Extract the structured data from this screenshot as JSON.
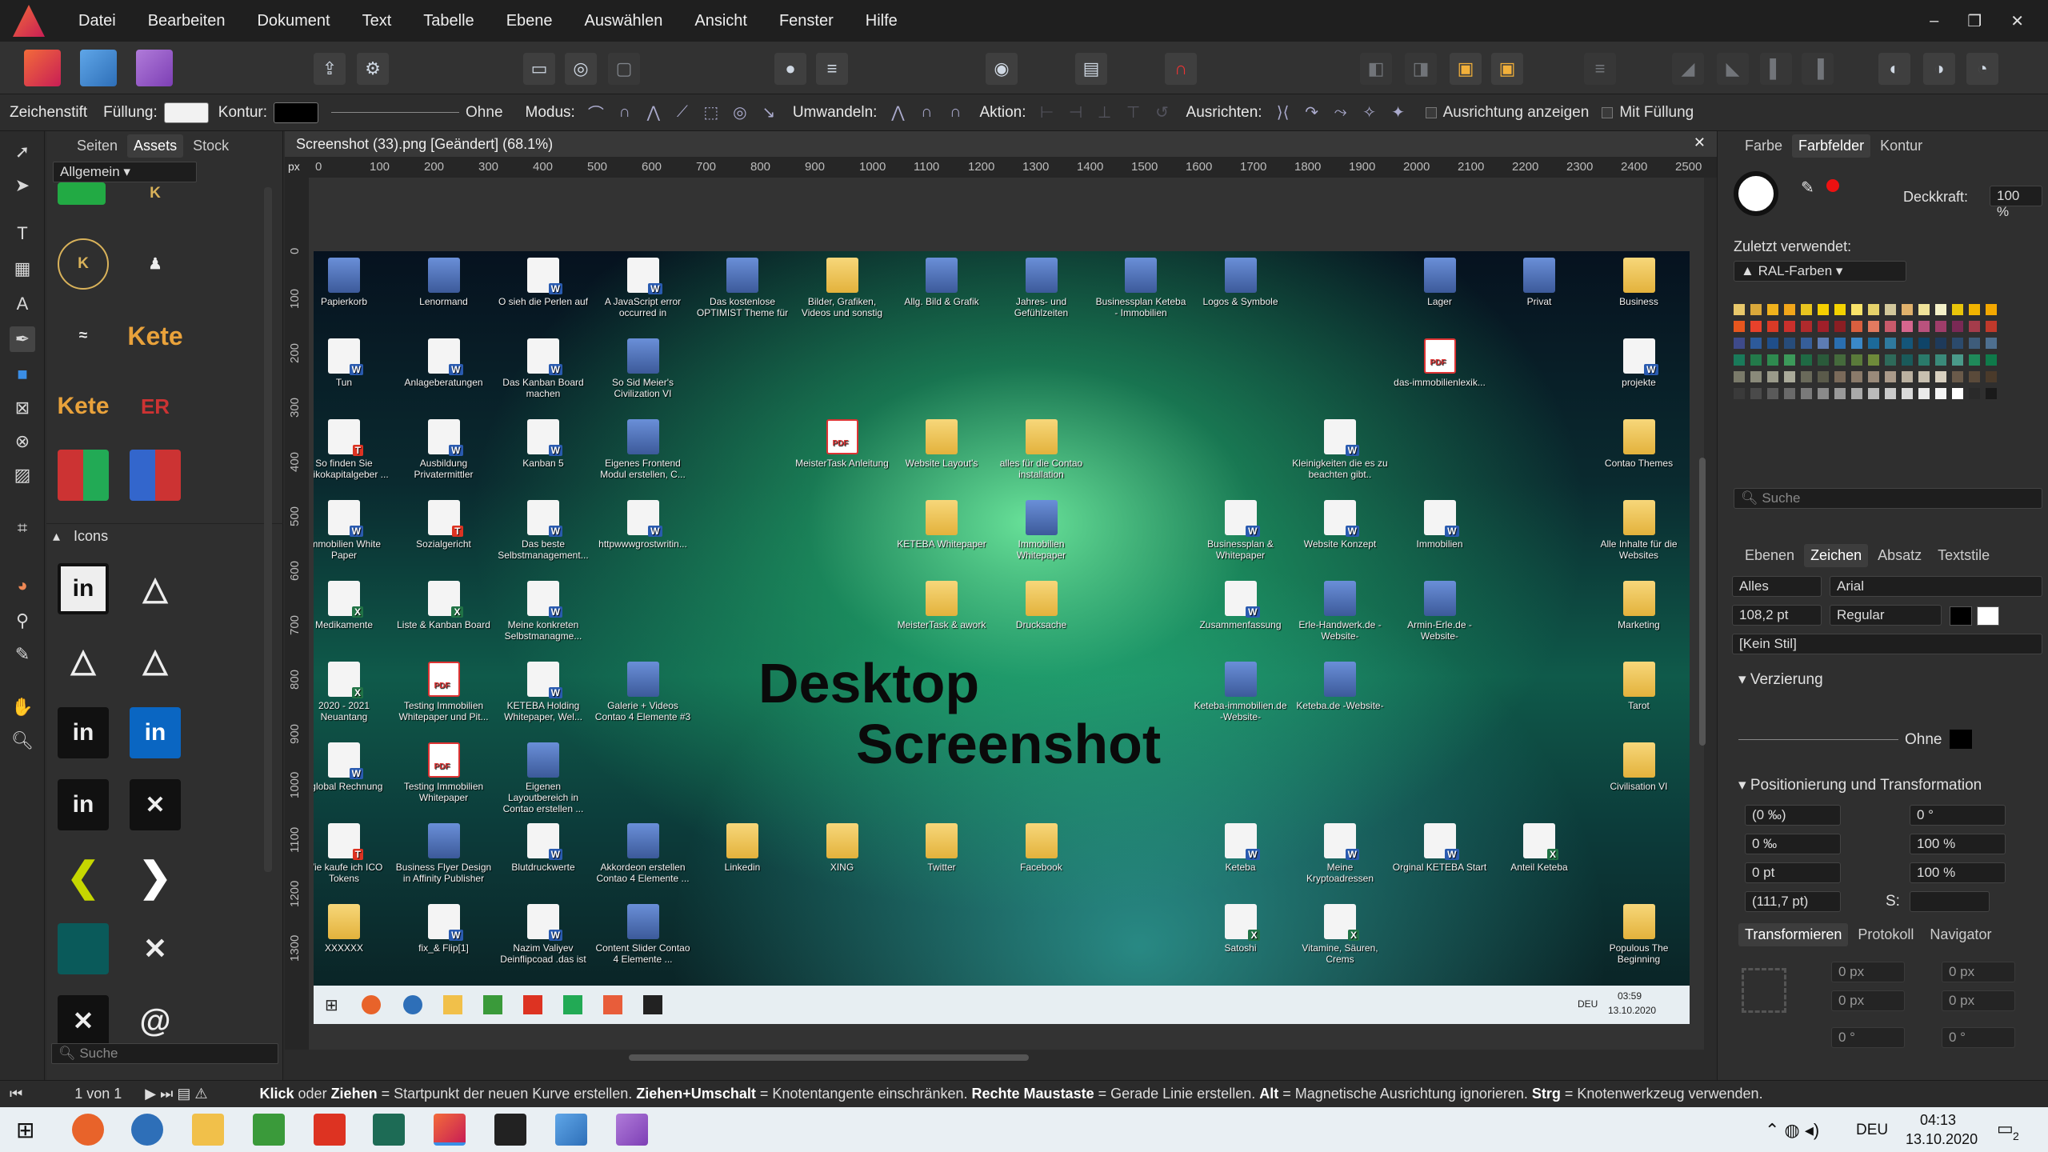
{
  "menu": [
    "Datei",
    "Bearbeiten",
    "Dokument",
    "Text",
    "Tabelle",
    "Ebene",
    "Auswählen",
    "Ansicht",
    "Fenster",
    "Hilfe"
  ],
  "window_controls": {
    "minimize": "–",
    "restore": "❐",
    "close": "✕"
  },
  "context": {
    "tool": "Zeichenstift",
    "fill_label": "Füllung:",
    "stroke_label": "Kontur:",
    "stroke_style": "Ohne",
    "mode_label": "Modus:",
    "convert_label": "Umwandeln:",
    "action_label": "Aktion:",
    "align_label": "Ausrichten:",
    "show_align": "Ausrichtung anzeigen",
    "with_fill": "Mit Füllung"
  },
  "left_panel": {
    "tabs": [
      "Seiten",
      "Assets",
      "Stock"
    ],
    "category": "Allgemein",
    "icons_section": "Icons",
    "search_placeholder": "Suche"
  },
  "document": {
    "title": "Screenshot (33).png [Geändert] (68.1%)",
    "ruler_unit": "px",
    "ruler_h": [
      "0",
      "100",
      "200",
      "300",
      "400",
      "500",
      "600",
      "700",
      "800",
      "900",
      "1000",
      "1100",
      "1200",
      "1300",
      "1400",
      "1500",
      "1600",
      "1700",
      "1800",
      "1900",
      "2000",
      "2100",
      "2200",
      "2300",
      "2400",
      "2500"
    ],
    "ruler_v": [
      "0",
      "100",
      "200",
      "300",
      "400",
      "500",
      "600",
      "700",
      "800",
      "900",
      "1000",
      "1100",
      "1200",
      "1300"
    ],
    "overlay_line1": "Desktop",
    "overlay_line2": "Screenshot",
    "desktop_icons": [
      {
        "label": "Papierkorb",
        "kind": "img"
      },
      {
        "label": "Lenormand",
        "kind": "img"
      },
      {
        "label": "O sieh die Perlen auf",
        "kind": "doc"
      },
      {
        "label": "A JavaScript error occurred in",
        "kind": "doc"
      },
      {
        "label": "Das kostenlose OPTIMIST Theme für",
        "kind": "img"
      },
      {
        "label": "Bilder, Grafiken, Videos und sonstig",
        "kind": "fold"
      },
      {
        "label": "Allg. Bild & Grafik",
        "kind": "img"
      },
      {
        "label": "Jahres- und Gefühlzeiten",
        "kind": "img"
      },
      {
        "label": "Businessplan Keteba - Immobilien",
        "kind": "img"
      },
      {
        "label": "Logos & Symbole",
        "kind": "img"
      },
      {
        "label": "Lager",
        "kind": "img"
      },
      {
        "label": "Privat",
        "kind": "img"
      },
      {
        "label": "Business",
        "kind": "fold"
      },
      {
        "label": "Tun",
        "kind": "doc"
      },
      {
        "label": "Anlageberatungen",
        "kind": "doc"
      },
      {
        "label": "Das Kanban Board machen",
        "kind": "doc"
      },
      {
        "label": "So Sid Meier's Civilization VI",
        "kind": "img"
      },
      {
        "label": "das-immobilienlexik...",
        "kind": "pdf"
      },
      {
        "label": "projekte",
        "kind": "doc"
      },
      {
        "label": "So finden Sie Risikokapitalgeber ...",
        "kind": "ttt"
      },
      {
        "label": "Ausbildung Privatermittler",
        "kind": "doc"
      },
      {
        "label": "Kanban 5",
        "kind": "doc"
      },
      {
        "label": "Eigenes Frontend Modul erstellen, C...",
        "kind": "img"
      },
      {
        "label": "MeisterTask Anleitung",
        "kind": "pdf"
      },
      {
        "label": "Website Layout's",
        "kind": "fold"
      },
      {
        "label": "alles für die Contao installation",
        "kind": "fold"
      },
      {
        "label": "Kleinigkeiten die es zu beachten gibt..",
        "kind": "doc"
      },
      {
        "label": "Contao Themes",
        "kind": "fold"
      },
      {
        "label": "Immobilien White Paper",
        "kind": "doc"
      },
      {
        "label": "Sozialgericht",
        "kind": "ttt"
      },
      {
        "label": "Das beste Selbstmanagement...",
        "kind": "doc"
      },
      {
        "label": "httpwwwgrostwritin...",
        "kind": "doc"
      },
      {
        "label": "KETEBA Whitepaper",
        "kind": "fold"
      },
      {
        "label": "Immobilien Whitepaper",
        "kind": "img"
      },
      {
        "label": "Businessplan & Whitepaper",
        "kind": "doc"
      },
      {
        "label": "Website Konzept",
        "kind": "doc"
      },
      {
        "label": "Immobilien",
        "kind": "doc"
      },
      {
        "label": "Alle Inhalte für die Websites",
        "kind": "fold"
      },
      {
        "label": "Medikamente",
        "kind": "xls"
      },
      {
        "label": "Liste & Kanban Board",
        "kind": "xls"
      },
      {
        "label": "Meine konkreten Selbstmanagme...",
        "kind": "doc"
      },
      {
        "label": "MeisterTask & awork",
        "kind": "fold"
      },
      {
        "label": "Drucksache",
        "kind": "fold"
      },
      {
        "label": "Zusammenfassung",
        "kind": "doc"
      },
      {
        "label": "Erle-Handwerk.de -Website-",
        "kind": "img"
      },
      {
        "label": "Armin-Erle.de -Website-",
        "kind": "img"
      },
      {
        "label": "Marketing",
        "kind": "fold"
      },
      {
        "label": "2020 - 2021 Neuantang",
        "kind": "xls"
      },
      {
        "label": "Testing Immobilien Whitepaper und Pit...",
        "kind": "pdf"
      },
      {
        "label": "KETEBA Holding Whitepaper, Wel...",
        "kind": "doc"
      },
      {
        "label": "Galerie + Videos Contao 4 Elemente #3",
        "kind": "img"
      },
      {
        "label": "Keteba-immobilien.de -Website-",
        "kind": "img"
      },
      {
        "label": "Keteba.de -Website-",
        "kind": "img"
      },
      {
        "label": "Tarot",
        "kind": "fold"
      },
      {
        "label": "eglobal Rechnung",
        "kind": "doc"
      },
      {
        "label": "Testing Immobilien Whitepaper",
        "kind": "pdf"
      },
      {
        "label": "Eigenen Layoutbereich in Contao erstellen ...",
        "kind": "img"
      },
      {
        "label": "Civilisation VI",
        "kind": "fold"
      },
      {
        "label": "Wie kaufe ich ICO Tokens",
        "kind": "ttt"
      },
      {
        "label": "Business Flyer Design in Affinity Publisher",
        "kind": "img"
      },
      {
        "label": "Blutdruckwerte",
        "kind": "doc"
      },
      {
        "label": "Akkordeon erstellen Contao 4 Elemente ...",
        "kind": "img"
      },
      {
        "label": "Linkedin",
        "kind": "fold"
      },
      {
        "label": "XING",
        "kind": "fold"
      },
      {
        "label": "Twitter",
        "kind": "fold"
      },
      {
        "label": "Facebook",
        "kind": "fold"
      },
      {
        "label": "Keteba",
        "kind": "doc"
      },
      {
        "label": "Meine Kryptoadressen",
        "kind": "doc"
      },
      {
        "label": "Orginal KETEBA Start",
        "kind": "doc"
      },
      {
        "label": "Anteil Keteba",
        "kind": "xls"
      },
      {
        "label": "XXXXXX",
        "kind": "fold"
      },
      {
        "label": "fix_& Flip[1]",
        "kind": "doc"
      },
      {
        "label": "Nazim Valiyev Deinflipcoad .das ist",
        "kind": "doc"
      },
      {
        "label": "Content Slider Contao 4 Elemente ...",
        "kind": "img"
      },
      {
        "label": "Satoshi",
        "kind": "xls"
      },
      {
        "label": "Vitamine, Säuren, Crems",
        "kind": "xls"
      },
      {
        "label": "Populous The Beginning",
        "kind": "fold"
      }
    ],
    "inner_taskbar": {
      "lang": "DEU",
      "time": "03:59",
      "date": "13.10.2020"
    }
  },
  "right_panel": {
    "tabs_top": [
      "Farbe",
      "Farbfelder",
      "Kontur"
    ],
    "opacity_label": "Deckkraft:",
    "opacity_value": "100 %",
    "recent_label": "Zuletzt verwendet:",
    "palette": "RAL-Farben",
    "search_placeholder": "Suche",
    "tabs_mid": [
      "Ebenen",
      "Zeichen",
      "Absatz",
      "Textstile"
    ],
    "filter": "Alles",
    "font": "Arial",
    "size": "108,2 pt",
    "weight": "Regular",
    "style": "[Kein Stil]",
    "decoration_title": "Verzierung",
    "decoration_stroke": "Ohne",
    "position_title": "Positionierung und Transformation",
    "kerning": "(0 ‰)",
    "tracking": "0 ‰",
    "baseline": "0 pt",
    "leading": "(111,7 pt)",
    "shear": "0 °",
    "hscale": "100 %",
    "vscale": "100 %",
    "s_label": "S:",
    "tabs_bottom": [
      "Transformieren",
      "Protokoll",
      "Navigator"
    ],
    "tx": "0 px",
    "ty": "0 px",
    "tw": "0 px",
    "th": "0 px",
    "tr": "0 °",
    "ts": "0 °"
  },
  "status": {
    "page": "1 von 1",
    "hint_parts": [
      "Klick",
      " oder ",
      "Ziehen",
      " = Startpunkt der neuen Kurve erstellen. ",
      "Ziehen+Umschalt",
      " = Knotentangente einschränken. ",
      "Rechte Maustaste",
      " = Gerade Linie erstellen. ",
      "Alt",
      " = Magnetische Ausrichtung ignorieren. ",
      "Strg",
      " = Knotenwerkzeug verwenden."
    ]
  },
  "taskbar": {
    "lang": "DEU",
    "time": "04:13",
    "date": "13.10.2020",
    "notifications": "2"
  },
  "colors": {
    "accent": "#3a8ee6",
    "brand": "#e85d3a"
  }
}
